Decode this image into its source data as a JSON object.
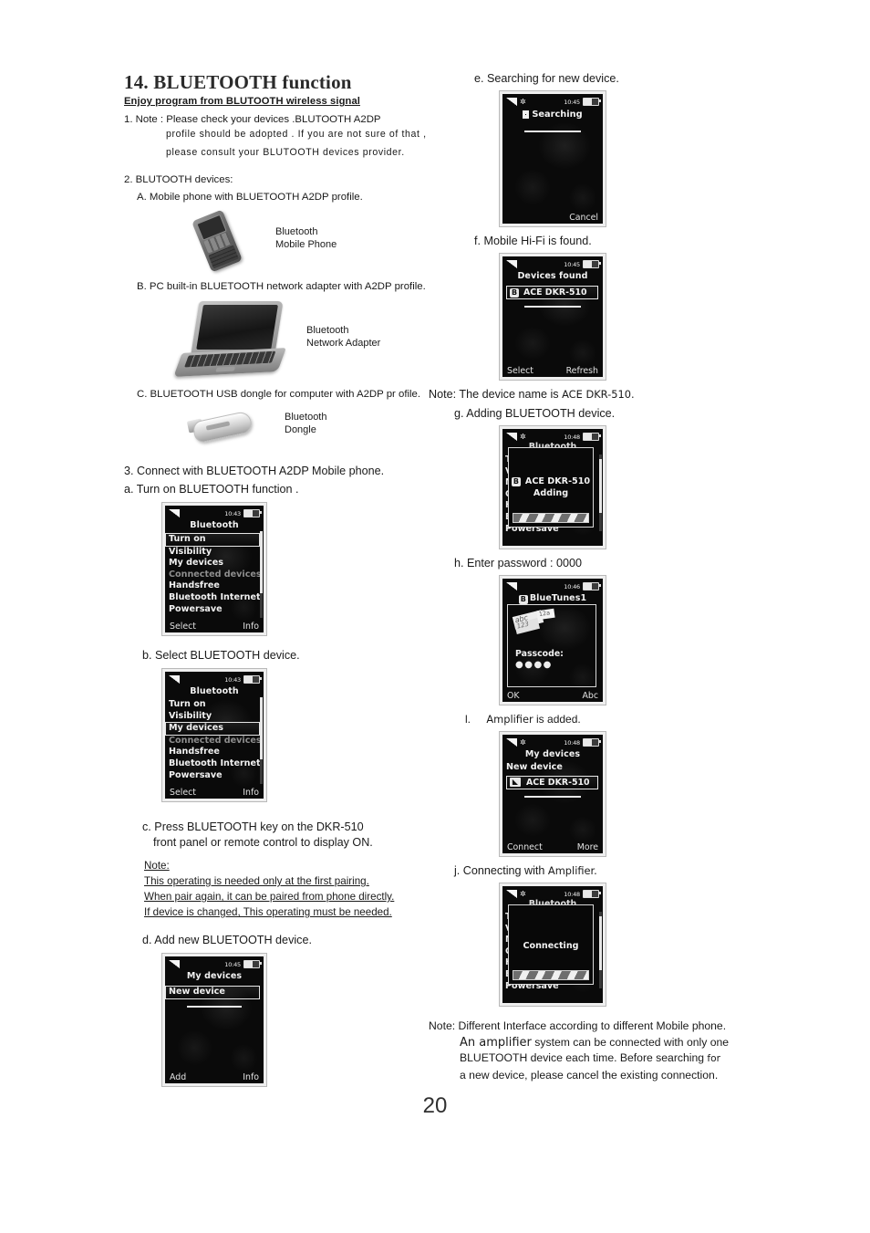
{
  "document": {
    "title": "14. BLUETOOTH function",
    "subtitle": "Enjoy program from BLUTOOTH wireless  signal",
    "page_number": "20"
  },
  "left": {
    "note1_line1": "1. Note : Please check your devices .BLUTOOTH A2DP",
    "note1_line2": "profile should be  adopted .  If  you  are  not  sure  of  that ,",
    "note1_line3": "please   consult   your  BLUTOOTH devices  provider.",
    "devices_heading": "2. BLUTOOTH   devices:",
    "device_a_text": "A. Mobile phone with BLUETOOTH A2DP profile.",
    "device_a_caption": "Bluetooth\nMobile Phone",
    "device_b_text": "B. PC built-in BLUETOOTH network adapter with A2DP profile.",
    "device_b_caption": "Bluetooth\nNetwork  Adapter",
    "device_c_text": "C. BLUETOOTH USB dongle for computer with A2DP pr ofile.",
    "device_c_caption": "Bluetooth\nDongle",
    "step3": "3. Connect with BLUETOOTH A2DP Mobile phone.",
    "step_a": "a. Turn on BLUETOOTH function .",
    "step_b": "b. Select  BLUETOOTH device.",
    "step_c_line1": "c. Press BLUETOOTH key on the DKR-510",
    "step_c_line2": "front panel or remote control to display ON.",
    "note_heading": "Note:",
    "note_line1": "This operating is needed only at the first pairing.",
    "note_line2": "When pair again, it can be paired from phone directly.",
    "note_line3": "If device is changed, This operating must be needed.",
    "step_d": "d. Add  new BLUETOOTH device."
  },
  "right": {
    "step_e": "e. Searching for new  device.",
    "step_f": "f. Mobile Hi-Fi is found.",
    "note_device_name_prefix": "Note: The device name is",
    "note_device_name_value": "ACE DKR-510.",
    "step_g": "g. Adding BLUETOOTH device.",
    "step_h": "h. Enter  password : 0000",
    "step_i_marker": "l.",
    "step_i_emph": "Amplifier",
    "step_i_rest": "is added.",
    "step_j_marker": "j.",
    "step_j_text": "Connecting with",
    "step_j_emph": "Amplifier.",
    "final_note_line1": "Note: Different Interface according to different Mobile phone.",
    "final_note_line2a": "An amplifier",
    "final_note_line2b": "system can be connected with only one",
    "final_note_line3a": "BLUETOOTH  device each time. Before searching",
    "final_note_line3b": "for",
    "final_note_line4": "a new device, please cancel the existing connection."
  },
  "screens": {
    "bt_menu_turnon": {
      "clock": "10:43",
      "title": "Bluetooth",
      "items": [
        "Turn on",
        "Visibility",
        "My devices",
        "Connected devices",
        "Handsfree",
        "Bluetooth Internet",
        "Powersave"
      ],
      "selected_index": 0,
      "disabled_index": 3,
      "softkey_left": "Select",
      "softkey_right": "Info"
    },
    "bt_menu_mydevices": {
      "clock": "10:43",
      "title": "Bluetooth",
      "items": [
        "Turn on",
        "Visibility",
        "My devices",
        "Connected devices",
        "Handsfree",
        "Bluetooth Internet",
        "Powersave"
      ],
      "selected_index": 2,
      "disabled_index": 3,
      "softkey_left": "Select",
      "softkey_right": "Info"
    },
    "my_devices_new": {
      "clock": "10:45",
      "title": "My devices",
      "item": "New device",
      "softkey_left": "Add",
      "softkey_right": "Info"
    },
    "searching": {
      "clock": "10:45",
      "title": "Searching",
      "softkey_right": "Cancel"
    },
    "devices_found": {
      "clock": "10:45",
      "title": "Devices found",
      "device": "ACE DKR-510",
      "badge": "B",
      "softkey_left": "Select",
      "softkey_right": "Refresh"
    },
    "adding": {
      "clock": "10:48",
      "ghost_title": "Bluetooth",
      "ghost_items": [
        "T",
        "V",
        "M",
        "C",
        "H",
        "B",
        "Powersave"
      ],
      "dialog_device": "ACE DKR-510",
      "dialog_status": "Adding",
      "badge": "B"
    },
    "passcode": {
      "clock": "10:46",
      "title": "BlueTunes1",
      "badge": "B",
      "label": "Passcode:",
      "dots": "●●●●",
      "ime_abc": "abc",
      "ime_123": "123",
      "ime_12a": "12a",
      "softkey_left": "OK",
      "softkey_right": "Abc"
    },
    "my_devices_added": {
      "clock": "10:48",
      "title": "My devices",
      "item_plain": "New device",
      "device": "ACE DKR-510",
      "softkey_left": "Connect",
      "softkey_right": "More"
    },
    "connecting": {
      "clock": "10:48",
      "ghost_title": "Bluetooth",
      "ghost_items": [
        "T",
        "V",
        "M",
        "C",
        "H",
        "B",
        "Powersave"
      ],
      "dialog_status": "Connecting"
    }
  }
}
